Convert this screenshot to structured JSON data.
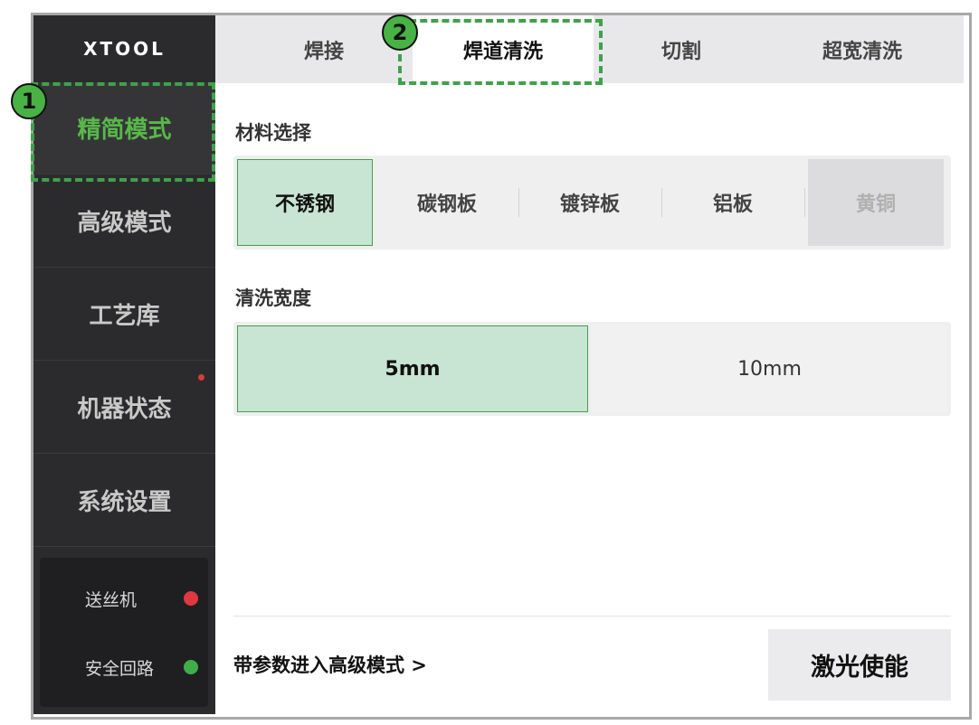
{
  "sidebar": {
    "logo": "XTOOL",
    "items": [
      {
        "label": "精简模式"
      },
      {
        "label": "高级模式"
      },
      {
        "label": "工艺库"
      },
      {
        "label": "机器状态"
      },
      {
        "label": "系统设置"
      }
    ],
    "status": [
      {
        "label": "送丝机",
        "color": "#e0383e"
      },
      {
        "label": "安全回路",
        "color": "#3fae49"
      }
    ]
  },
  "tabs": [
    {
      "label": "焊接"
    },
    {
      "label": "焊道清洗"
    },
    {
      "label": "切割"
    },
    {
      "label": "超宽清洗"
    }
  ],
  "material": {
    "title": "材料选择",
    "options": [
      "不锈钢",
      "碳钢板",
      "镀锌板",
      "铝板",
      "黄铜"
    ]
  },
  "width": {
    "title": "清洗宽度",
    "options": [
      "5mm",
      "10mm"
    ]
  },
  "footer": {
    "advanced_link": "带参数进入高级模式 >",
    "laser_button": "激光使能"
  },
  "annotations": {
    "one": "1",
    "two": "2"
  },
  "colors": {
    "accent": "#3fa14a",
    "selected_fill": "#c8e4d2",
    "sidebar_bg": "#2b2b2d"
  }
}
